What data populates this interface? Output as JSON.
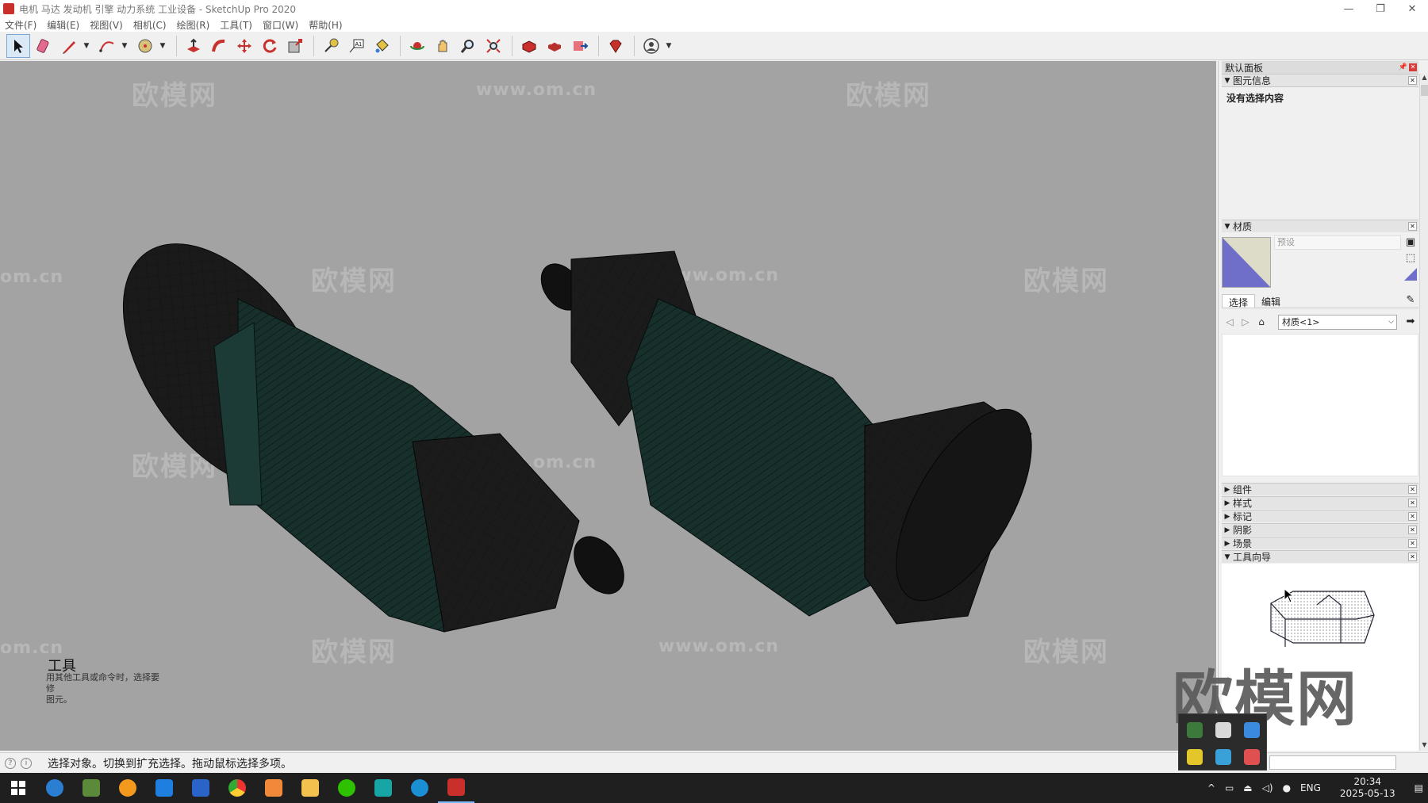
{
  "window": {
    "title": "电机 马达 发动机 引擎 动力系统 工业设备 - SketchUp Pro 2020",
    "minimize": "—",
    "restore": "❐",
    "close": "✕"
  },
  "menu": [
    "文件(F)",
    "编辑(E)",
    "视图(V)",
    "相机(C)",
    "绘图(R)",
    "工具(T)",
    "窗口(W)",
    "帮助(H)"
  ],
  "watermarks": {
    "cn": "欧模网",
    "url": "www.om.cn",
    "url_partial": "om.cn"
  },
  "panel": {
    "title": "默认面板",
    "entity_info": {
      "header": "图元信息",
      "empty_text": "没有选择内容"
    },
    "materials": {
      "header": "材质",
      "name_placeholder": "预设",
      "tab_select": "选择",
      "tab_edit": "编辑",
      "collection": "材质<1>"
    },
    "collapsed_sections": [
      "组件",
      "样式",
      "标记",
      "阴影",
      "场景"
    ],
    "instructor": {
      "header": "工具向导",
      "title": "工具",
      "desc_line1": "用其他工具或命令时，选择要修",
      "desc_line2": "图元。"
    }
  },
  "status": {
    "text": "选择对象。切换到扩充选择。拖动鼠标选择多项。"
  },
  "taskbar": {
    "lang": "ENG",
    "time": "20:34",
    "date": "2025-05-13"
  },
  "logo_text": "欧模网"
}
